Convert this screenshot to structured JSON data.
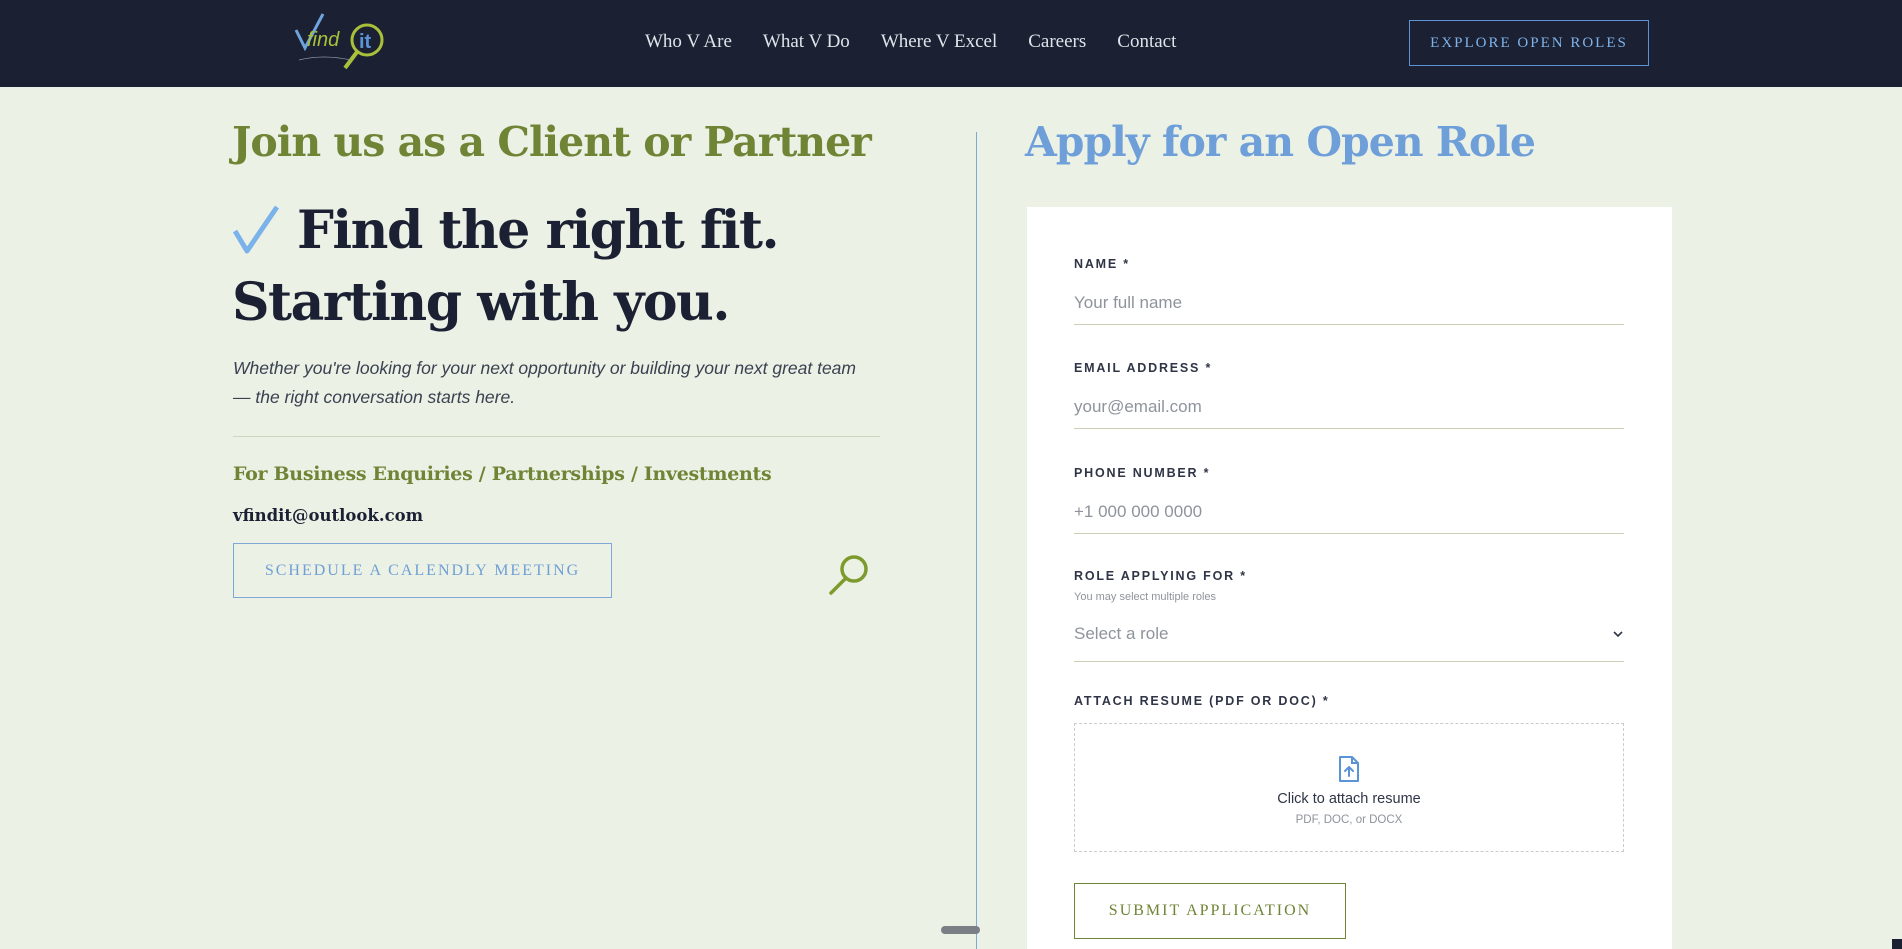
{
  "header": {
    "logo_icon": "vfindit-logo-icon",
    "nav": [
      "Who V Are",
      "What V Do",
      "Where V Excel",
      "Careers",
      "Contact"
    ],
    "cta_label": "EXPLORE OPEN ROLES"
  },
  "left": {
    "heading": "Join us as a Client or Partner",
    "check_icon": "checkmark-icon",
    "tagline_line1": "Find the right fit.",
    "tagline_line2": "Starting with you.",
    "intro": "Whether you're looking for your next opportunity or building your next great team — the right conversation starts here.",
    "business_heading": "For Business Enquiries / Partnerships / Investments",
    "business_email": "vfindit@outlook.com",
    "calendly_label": "SCHEDULE A CALENDLY MEETING",
    "magnifier_icon": "magnifier-icon"
  },
  "right": {
    "heading": "Apply for an Open Role",
    "form": {
      "name_label": "NAME *",
      "name_placeholder": "Your full name",
      "email_label": "EMAIL ADDRESS *",
      "email_placeholder": "your@email.com",
      "phone_label": "PHONE NUMBER *",
      "phone_placeholder": "+1 000 000 0000",
      "role_label": "ROLE APPLYING FOR *",
      "role_hint": "You may select multiple roles",
      "role_selected": "Select a role",
      "resume_label": "ATTACH RESUME (PDF OR DOC) *",
      "resume_title": "Click to attach resume",
      "resume_sub": "PDF, DOC, or DOCX",
      "upload_icon": "file-upload-icon",
      "submit_label": "SUBMIT APPLICATION"
    }
  },
  "colors": {
    "header_bg": "#1b2133",
    "page_bg": "#ecf1e6",
    "olive": "#6f8435",
    "blue": "#6f9fd9"
  }
}
